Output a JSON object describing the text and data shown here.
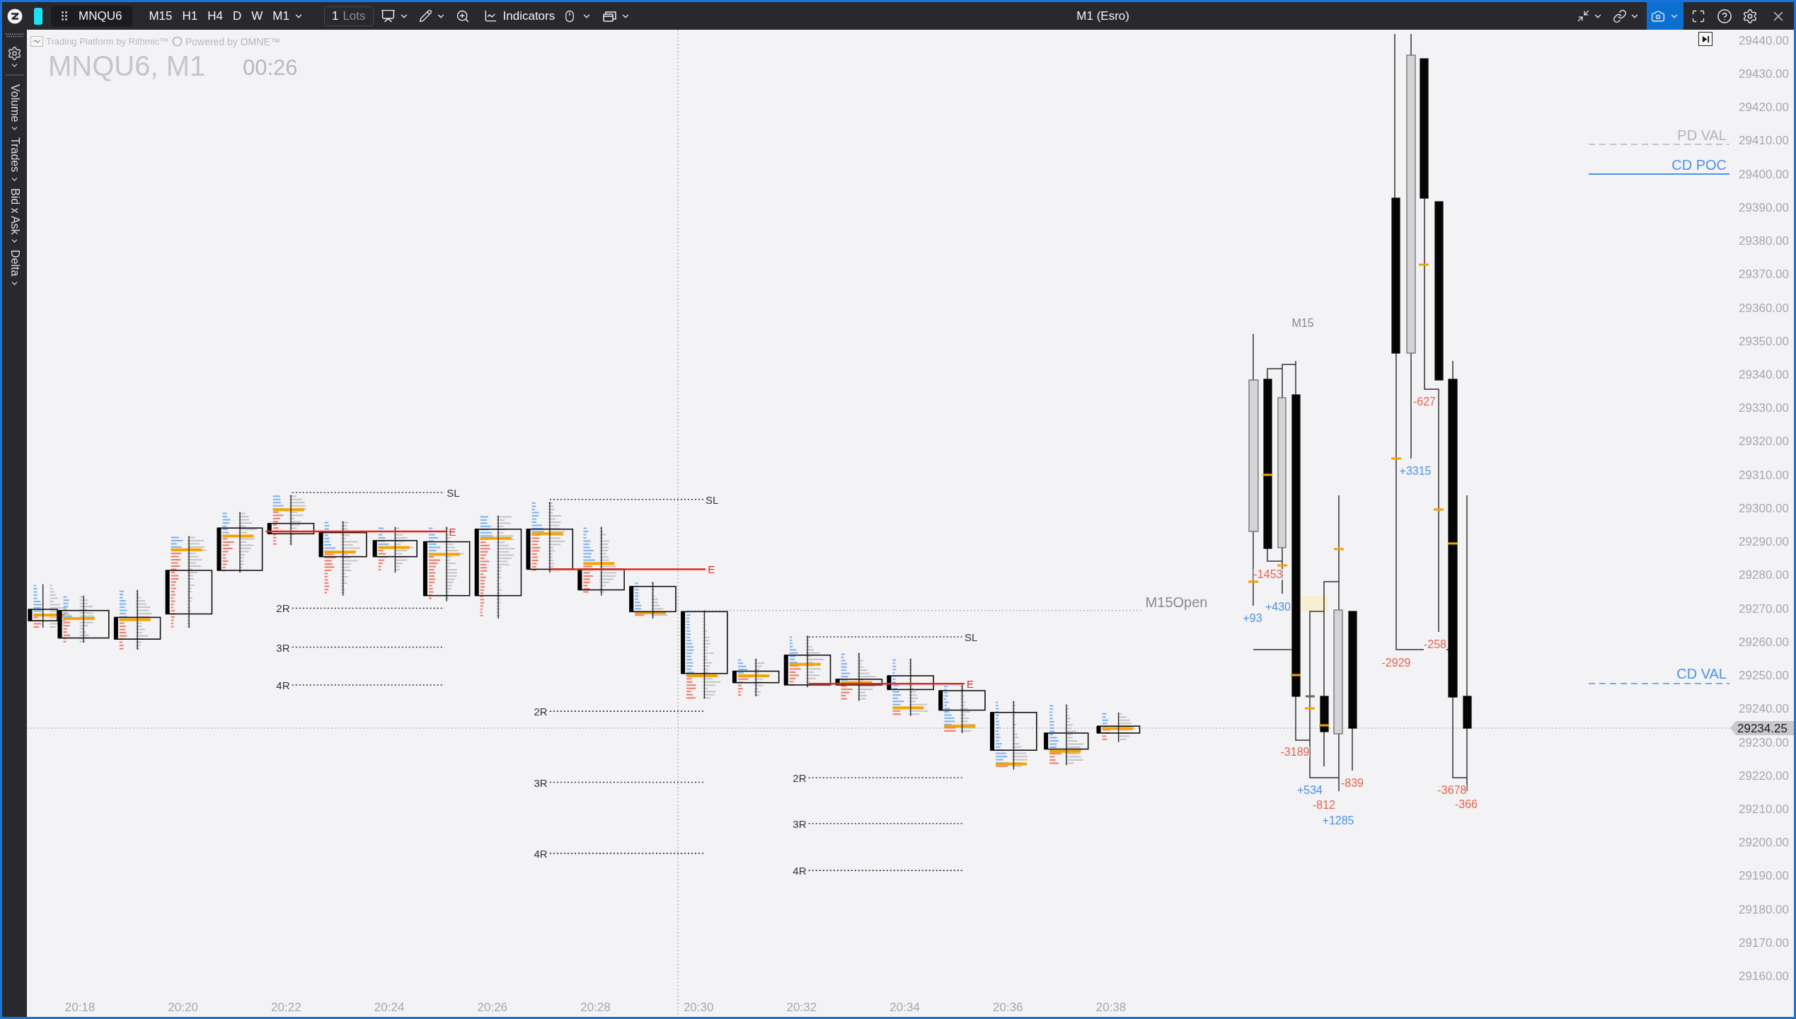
{
  "window": {
    "title": "M1 (Esro)"
  },
  "toolbar": {
    "symbol": "MNQU6",
    "timeframes": [
      "M15",
      "H1",
      "H4",
      "D",
      "W"
    ],
    "timeframe_menu": "M1",
    "lots": {
      "value": "1",
      "unit": "Lots"
    },
    "indicators": "Indicators",
    "camera_menu": {
      "active": true
    }
  },
  "sidebar": {
    "modes": [
      "Volume",
      "Trades",
      "Bid x Ask",
      "Delta"
    ]
  },
  "chart": {
    "branding": "Trading Platform by Rithmic™",
    "powered_by": "Powered by OMNE™",
    "instrument": "MNQU6, M1",
    "timer": "00:26",
    "price_axis": [
      "29440.00",
      "29430.00",
      "29420.00",
      "29410.00",
      "29400.00",
      "29390.00",
      "29380.00",
      "29370.00",
      "29360.00",
      "29350.00",
      "29340.00",
      "29330.00",
      "29320.00",
      "29310.00",
      "29300.00",
      "29290.00",
      "29280.00",
      "29270.00",
      "29260.00",
      "29250.00",
      "29240.00",
      "29230.00",
      "29220.00",
      "29210.00",
      "29200.00",
      "29190.00",
      "29180.00",
      "29170.00",
      "29160.00"
    ],
    "current_price": "29234.25",
    "time_axis": [
      "20:18",
      "20:20",
      "20:22",
      "20:24",
      "20:26",
      "20:28",
      "20:30",
      "20:32",
      "20:34",
      "20:36",
      "20:38"
    ],
    "levels": [
      {
        "label": "PD VAL",
        "color": "#b5b5b8",
        "kind": "dashed"
      },
      {
        "label": "CD POC",
        "color": "#4c95e8",
        "kind": "solid"
      },
      {
        "label": "CD VAL",
        "color": "#4c95e8",
        "kind": "dashed"
      }
    ],
    "setups": [
      {
        "marks": [
          {
            "kind": "stop",
            "label": "SL"
          },
          {
            "kind": "entry",
            "label": "E"
          },
          {
            "kind": "target",
            "label": "2R"
          },
          {
            "kind": "target",
            "label": "3R"
          },
          {
            "kind": "target",
            "label": "4R"
          }
        ]
      },
      {
        "marks": [
          {
            "kind": "stop",
            "label": "SL"
          },
          {
            "kind": "entry",
            "label": "E"
          },
          {
            "kind": "target",
            "label": "2R"
          },
          {
            "kind": "target",
            "label": "3R"
          },
          {
            "kind": "target",
            "label": "4R"
          }
        ]
      },
      {
        "marks": [
          {
            "kind": "stop",
            "label": "SL"
          },
          {
            "kind": "entry",
            "label": "E"
          },
          {
            "kind": "target",
            "label": "2R"
          },
          {
            "kind": "target",
            "label": "3R"
          },
          {
            "kind": "target",
            "label": "4R"
          }
        ]
      }
    ],
    "m15_open": "M15Open",
    "higher_timeframe": {
      "label": "M15",
      "deltas": [
        {
          "text": "-1453",
          "color": "#e5644e"
        },
        {
          "text": "+430",
          "color": "#4d94e6"
        },
        {
          "text": "+93",
          "color": "#4d94e6"
        },
        {
          "text": "-3189",
          "color": "#e5644e"
        },
        {
          "text": "+534",
          "color": "#4d94e6"
        },
        {
          "text": "-812",
          "color": "#e5644e"
        },
        {
          "text": "+1285",
          "color": "#4d94e6"
        },
        {
          "text": "-839",
          "color": "#e5644e"
        },
        {
          "text": "-627",
          "color": "#e5644e"
        },
        {
          "text": "+3315",
          "color": "#4d94e6"
        },
        {
          "text": "-2929",
          "color": "#e5644e"
        },
        {
          "text": "-258",
          "color": "#e5644e"
        },
        {
          "text": "-3678",
          "color": "#e5644e"
        },
        {
          "text": "-366",
          "color": "#e5644e"
        }
      ]
    }
  }
}
